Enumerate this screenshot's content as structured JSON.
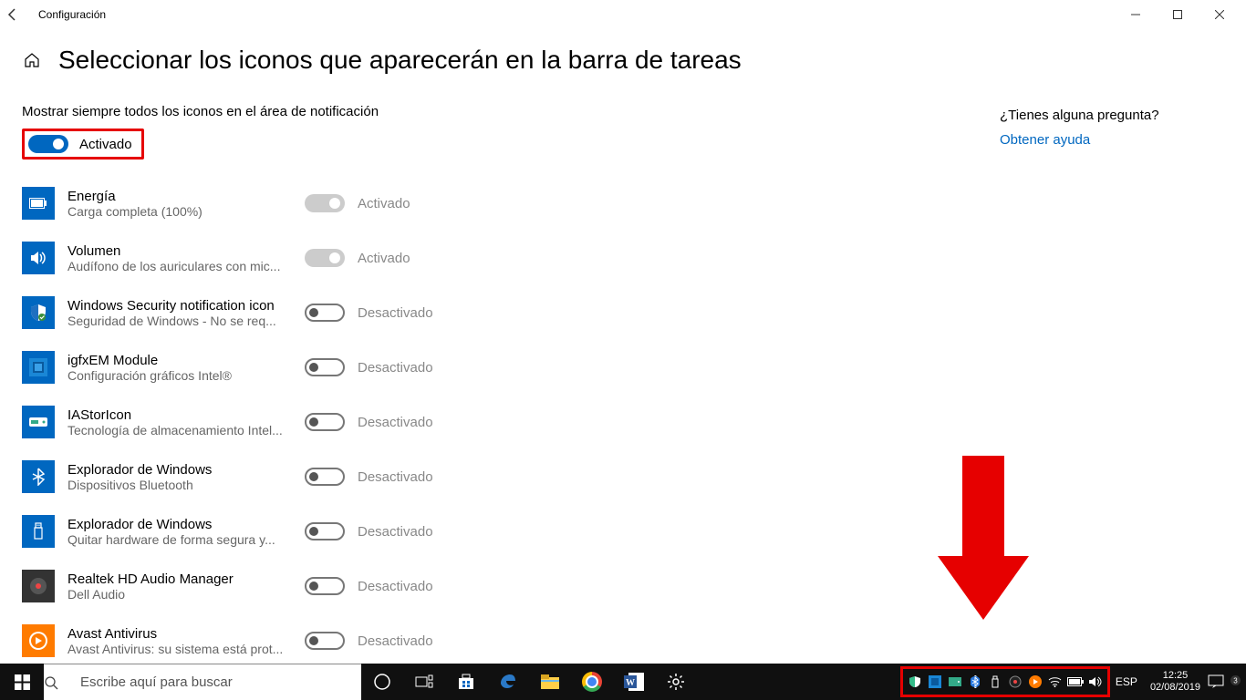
{
  "window": {
    "title": "Configuración",
    "min": "—",
    "max": "□",
    "close": "✕"
  },
  "page": {
    "heading": "Seleccionar los iconos que aparecerán en la barra de tareas",
    "subheading": "Mostrar siempre todos los iconos en el área de notificación",
    "master_toggle_label": "Activado",
    "master_toggle_on": true
  },
  "items": [
    {
      "title": "Energía",
      "sub": "Carga completa (100%)",
      "state": "Activado",
      "on": true,
      "icon": "battery"
    },
    {
      "title": "Volumen",
      "sub": "Audífono de los auriculares con mic...",
      "state": "Activado",
      "on": true,
      "icon": "volume"
    },
    {
      "title": "Windows Security notification icon",
      "sub": "Seguridad de Windows - No se req...",
      "state": "Desactivado",
      "on": false,
      "icon": "shield"
    },
    {
      "title": "igfxEM Module",
      "sub": "Configuración gráficos Intel®",
      "state": "Desactivado",
      "on": false,
      "icon": "intel"
    },
    {
      "title": "IAStorIcon",
      "sub": "Tecnología de almacenamiento Intel...",
      "state": "Desactivado",
      "on": false,
      "icon": "storage"
    },
    {
      "title": "Explorador de Windows",
      "sub": "Dispositivos Bluetooth",
      "state": "Desactivado",
      "on": false,
      "icon": "bluetooth"
    },
    {
      "title": "Explorador de Windows",
      "sub": "Quitar hardware de forma segura y...",
      "state": "Desactivado",
      "on": false,
      "icon": "usb"
    },
    {
      "title": "Realtek HD Audio Manager",
      "sub": "Dell Audio",
      "state": "Desactivado",
      "on": false,
      "icon": "audio"
    },
    {
      "title": "Avast Antivirus",
      "sub": "Avast Antivirus: su sistema está prot...",
      "state": "Desactivado",
      "on": false,
      "icon": "avast"
    }
  ],
  "aside": {
    "question": "¿Tienes alguna pregunta?",
    "help_link": "Obtener ayuda"
  },
  "taskbar": {
    "search_placeholder": "Escribe aquí para buscar",
    "language": "ESP",
    "time": "12:25",
    "date": "02/08/2019"
  }
}
